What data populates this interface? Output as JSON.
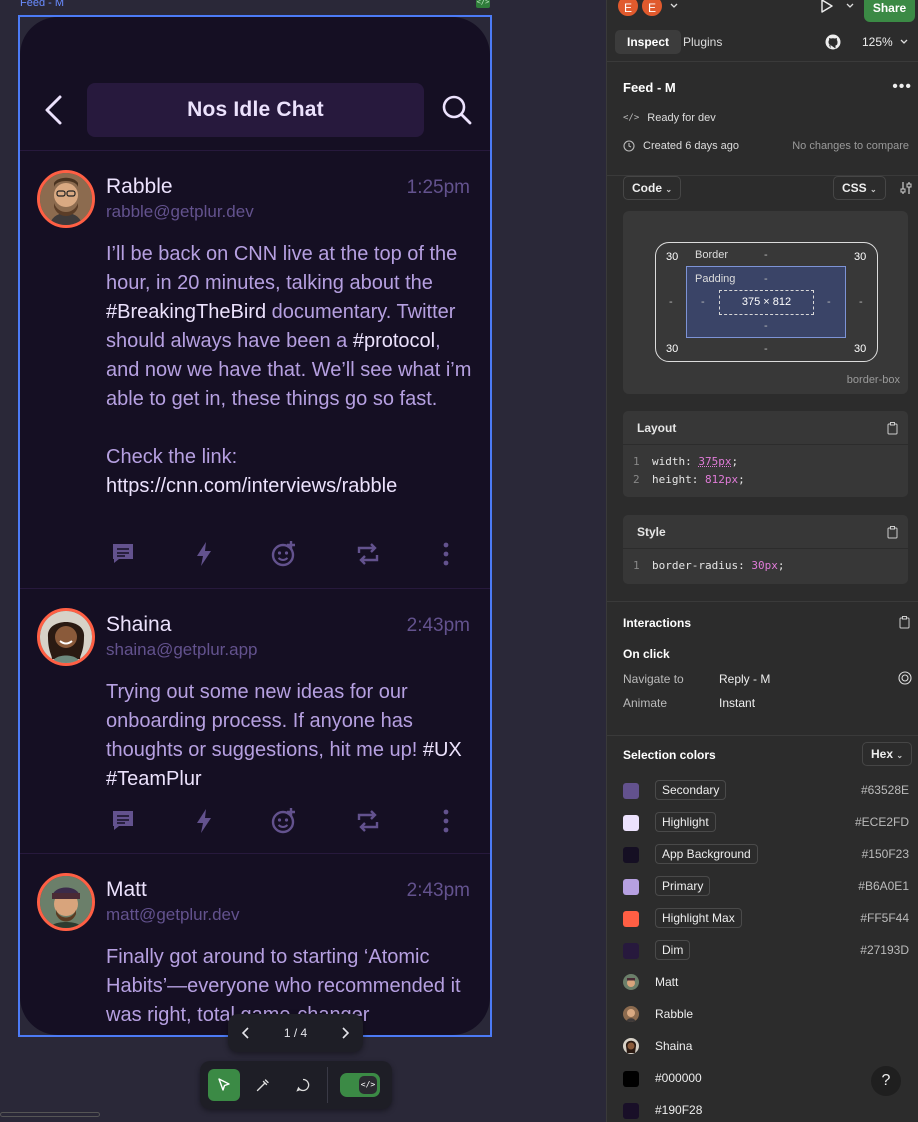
{
  "frame": {
    "label": "Feed - M"
  },
  "app": {
    "title": "Nos Idle Chat",
    "posts": [
      {
        "name": "Rabble",
        "email": "rabble@getplur.dev",
        "time": "1:25pm",
        "body_parts": [
          {
            "t": "I’ll be back on CNN live at the top of the hour, in 20 minutes, talking about the "
          },
          {
            "t": "#BreakingTheBird",
            "hl": true
          },
          {
            "t": " documentary. Twitter should always have been a "
          },
          {
            "t": "#protocol",
            "hl": true
          },
          {
            "t": ", and now we have that. We’ll see what i’m able to get in, these things go so fast.\n\nCheck the link:\n"
          },
          {
            "t": "https://cnn.com/interviews/rabble",
            "hl": true
          }
        ]
      },
      {
        "name": "Shaina",
        "email": "shaina@getplur.app",
        "time": "2:43pm",
        "body_parts": [
          {
            "t": "Trying out some new ideas for our onboarding process. If anyone has thoughts or suggestions, hit me up! "
          },
          {
            "t": "#UX #TeamPlur",
            "hl": true
          }
        ]
      },
      {
        "name": "Matt",
        "email": "matt@getplur.dev",
        "time": "2:43pm",
        "body_parts": [
          {
            "t": "Finally got around to starting ‘Atomic Habits’—everyone who recommended it was right, total game-changer"
          }
        ]
      }
    ]
  },
  "pager": {
    "text": "1 / 4"
  },
  "panel": {
    "user_initials": [
      "E",
      "E"
    ],
    "share": "Share",
    "tabs": {
      "inspect": "Inspect",
      "plugins": "Plugins"
    },
    "zoom": "125%",
    "frame_name": "Feed - M",
    "status": "Ready for dev",
    "created": "Created 6 days ago",
    "compare": "No changes to compare",
    "code_dropdown": "Code",
    "css_dropdown": "CSS",
    "boxmodel": {
      "border_label": "Border",
      "padding_label": "Padding",
      "size": "375 × 812",
      "corner": "30",
      "dash": "-",
      "sizing": "border-box"
    },
    "layout": {
      "title": "Layout",
      "lines": [
        {
          "n": "1",
          "prop": "width: ",
          "val": "375px",
          "end": ";"
        },
        {
          "n": "2",
          "prop": "height: ",
          "val": "812px",
          "end": ";"
        }
      ]
    },
    "style": {
      "title": "Style",
      "lines": [
        {
          "n": "1",
          "prop": "border-radius: ",
          "val": "30px",
          "end": ";"
        }
      ]
    },
    "interactions": {
      "title": "Interactions",
      "trigger": "On click",
      "navigate_label": "Navigate to",
      "navigate_value": "Reply - M",
      "animate_label": "Animate",
      "animate_value": "Instant"
    },
    "selection_colors": {
      "title": "Selection colors",
      "format": "Hex",
      "items": [
        {
          "name": "Secondary",
          "hex": "#63528E",
          "swatch": "#63528E",
          "tag": true
        },
        {
          "name": "Highlight",
          "hex": "#ECE2FD",
          "swatch": "#ECE2FD",
          "tag": true
        },
        {
          "name": "App Background",
          "hex": "#150F23",
          "swatch": "#150F23",
          "tag": true
        },
        {
          "name": "Primary",
          "hex": "#B6A0E1",
          "swatch": "#B6A0E1",
          "tag": true
        },
        {
          "name": "Highlight Max",
          "hex": "#FF5F44",
          "swatch": "#FF5F44",
          "tag": true
        },
        {
          "name": "Dim",
          "hex": "#27193D",
          "swatch": "#27193D",
          "tag": true
        },
        {
          "name": "Matt",
          "hex": "",
          "avatar": true
        },
        {
          "name": "Rabble",
          "hex": "",
          "avatar": true
        },
        {
          "name": "Shaina",
          "hex": "",
          "avatar": true
        },
        {
          "name": "#000000",
          "hex": "",
          "swatch": "#000000"
        },
        {
          "name": "#190F28",
          "hex": "",
          "swatch": "#190F28"
        }
      ]
    },
    "help": "?"
  },
  "colors": {
    "app_bg": "#150F23",
    "dim": "#27193D",
    "secondary": "#63528E",
    "primary": "#B6A0E1",
    "highlight": "#ECE2FD",
    "highlight_max": "#FF5F44",
    "accent_green": "#3B8A45",
    "selection_blue": "#4C7BF6"
  }
}
